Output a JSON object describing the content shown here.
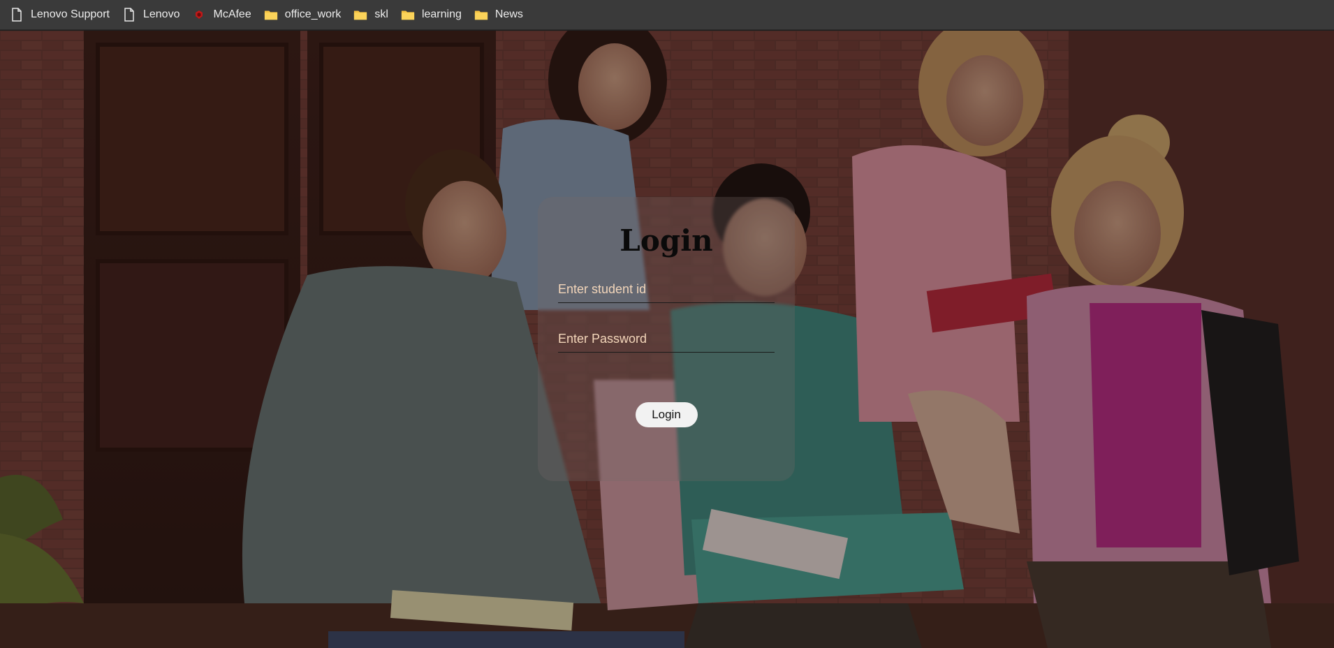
{
  "bookmarks": [
    {
      "label": "Lenovo Support",
      "icon": "page-icon"
    },
    {
      "label": "Lenovo",
      "icon": "page-icon"
    },
    {
      "label": "McAfee",
      "icon": "mcafee-icon"
    },
    {
      "label": "office_work",
      "icon": "folder-icon"
    },
    {
      "label": "skl",
      "icon": "folder-icon"
    },
    {
      "label": "learning",
      "icon": "folder-icon"
    },
    {
      "label": "News",
      "icon": "folder-icon"
    }
  ],
  "login": {
    "title": "Login",
    "student_id_placeholder": "Enter student id",
    "password_placeholder": "Enter Password",
    "button_label": "Login"
  },
  "colors": {
    "toolbar_bg": "#3a3a3a",
    "folder": "#f5c242",
    "mcafee_red": "#c01818"
  }
}
